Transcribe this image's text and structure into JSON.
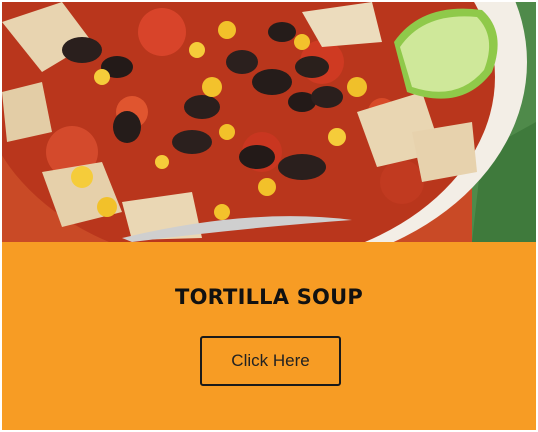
{
  "card": {
    "image_subject": "tortilla soup bowl",
    "title": "TORTILLA SOUP",
    "button_label": "Click Here"
  },
  "colors": {
    "card_background": "#f79c24",
    "title_text": "#111111",
    "button_border": "#1a1a1a"
  }
}
